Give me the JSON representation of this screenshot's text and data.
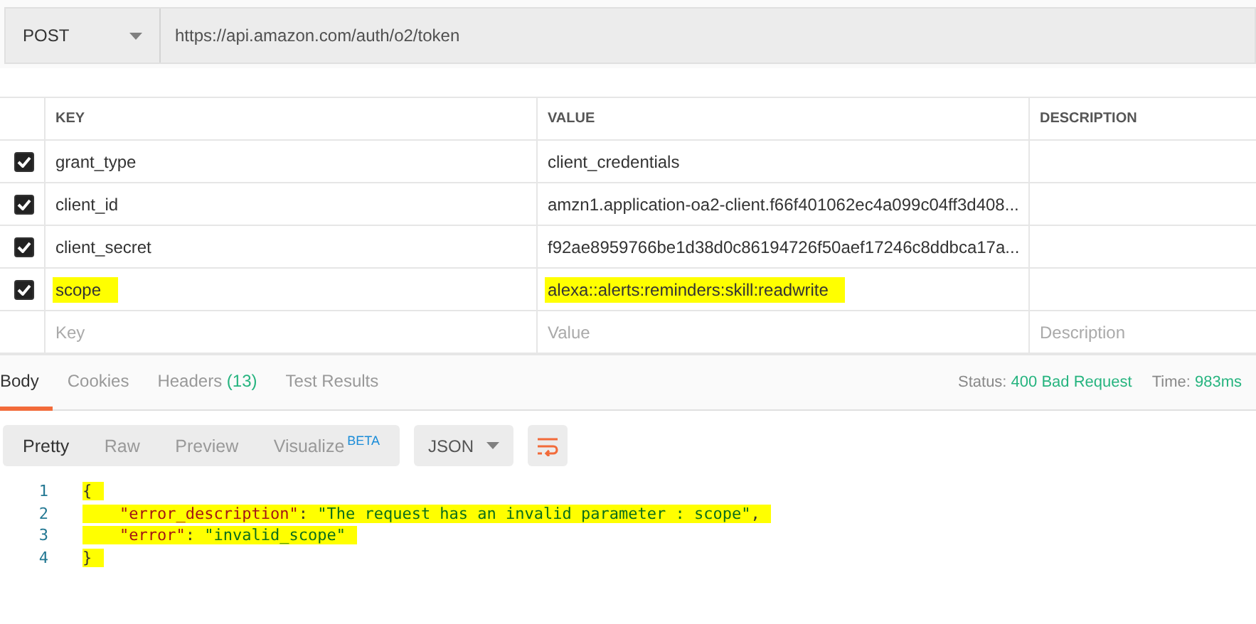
{
  "request": {
    "method": "POST",
    "url": "https://api.amazon.com/auth/o2/token"
  },
  "params": {
    "columns": [
      "KEY",
      "VALUE",
      "DESCRIPTION"
    ],
    "rows": [
      {
        "checked": true,
        "key": "grant_type",
        "value": "client_credentials",
        "highlighted": false
      },
      {
        "checked": true,
        "key": "client_id",
        "value": "amzn1.application-oa2-client.f66f401062ec4a099c04ff3d408...",
        "highlighted": false
      },
      {
        "checked": true,
        "key": "client_secret",
        "value": "f92ae8959766be1d38d0c86194726f50aef17246c8ddbca17a...",
        "highlighted": false
      },
      {
        "checked": true,
        "key": "scope",
        "value": "alexa::alerts:reminders:skill:readwrite",
        "highlighted": true
      }
    ],
    "new_row": {
      "key_placeholder": "Key",
      "value_placeholder": "Value",
      "description_placeholder": "Description"
    }
  },
  "response": {
    "tabs": [
      {
        "label": "Body",
        "selected": true
      },
      {
        "label": "Cookies",
        "selected": false
      },
      {
        "label": "Headers",
        "count": "(13)",
        "selected": false
      },
      {
        "label": "Test Results",
        "selected": false
      }
    ],
    "status_label": "Status:",
    "status": "400 Bad Request",
    "time_label": "Time:",
    "time": "983ms",
    "views": [
      {
        "label": "Pretty",
        "selected": true
      },
      {
        "label": "Raw",
        "selected": false
      },
      {
        "label": "Preview",
        "selected": false
      },
      {
        "label": "Visualize",
        "badge": "BETA",
        "selected": false
      }
    ],
    "format": "JSON",
    "code": [
      {
        "number": "1",
        "highlighted": true,
        "tokens": [
          {
            "kind": "punct",
            "text": "{"
          }
        ]
      },
      {
        "number": "2",
        "highlighted": true,
        "tokens": [
          {
            "kind": "key",
            "text": "\"error_description\""
          },
          {
            "kind": "punct",
            "text": ": "
          },
          {
            "kind": "string",
            "text": "\"The request has an invalid parameter : scope\""
          },
          {
            "kind": "punct",
            "text": ","
          }
        ]
      },
      {
        "number": "3",
        "highlighted": true,
        "tokens": [
          {
            "kind": "key",
            "text": "\"error\""
          },
          {
            "kind": "punct",
            "text": ": "
          },
          {
            "kind": "string",
            "text": "\"invalid_scope\""
          }
        ]
      },
      {
        "number": "4",
        "highlighted": true,
        "tokens": [
          {
            "kind": "punct",
            "text": "}"
          }
        ]
      }
    ]
  }
}
